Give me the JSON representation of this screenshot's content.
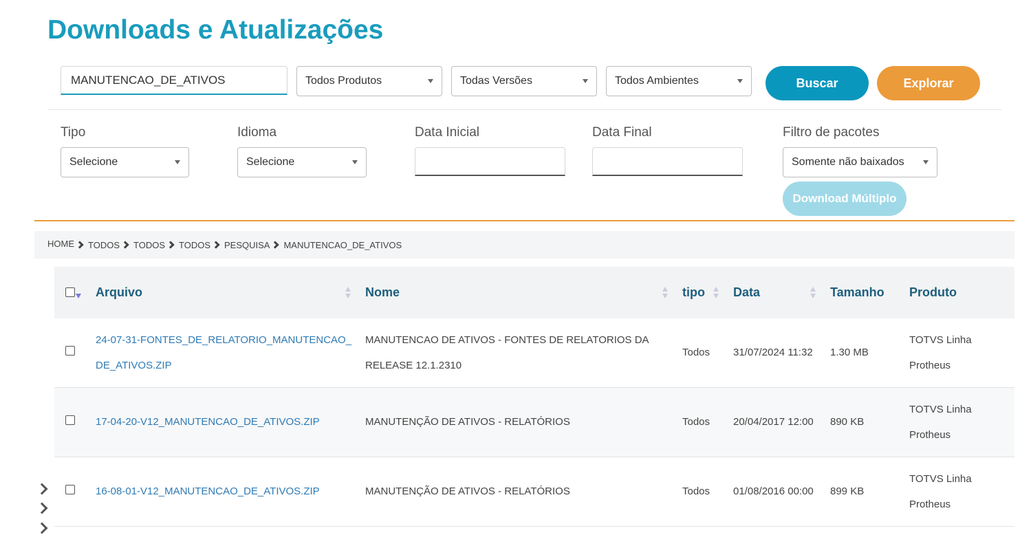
{
  "page_title": "Downloads e Atualizações",
  "search": {
    "value": "MANUTENCAO_DE_ATIVOS"
  },
  "selects": {
    "produtos": "Todos Produtos",
    "versoes": "Todas Versões",
    "ambientes": "Todos Ambientes"
  },
  "buttons": {
    "buscar": "Buscar",
    "explorar": "Explorar",
    "download_multiplo": "Download Múltiplo"
  },
  "filters": {
    "tipo": {
      "label": "Tipo",
      "value": "Selecione"
    },
    "idioma": {
      "label": "Idioma",
      "value": "Selecione"
    },
    "data_inicial": {
      "label": "Data Inicial",
      "value": ""
    },
    "data_final": {
      "label": "Data Final",
      "value": ""
    },
    "filtro_pacotes": {
      "label": "Filtro de pacotes",
      "value": "Somente não baixados"
    }
  },
  "breadcrumb": [
    "HOME",
    "TODOS",
    "TODOS",
    "TODOS",
    "PESQUISA",
    "MANUTENCAO_DE_ATIVOS"
  ],
  "table": {
    "headers": {
      "arquivo": "Arquivo",
      "nome": "Nome",
      "tipo": "tipo",
      "data": "Data",
      "tamanho": "Tamanho",
      "produto": "Produto"
    },
    "rows": [
      {
        "arquivo_l1": "24-07-31-FONTES_DE_RELATORIO_MANUTENCAO_",
        "arquivo_l2": "DE_ATIVOS.ZIP",
        "nome_l1": "MANUTENCAO DE ATIVOS - FONTES DE RELATORIOS DA",
        "nome_l2": "RELEASE 12.1.2310",
        "tipo": "Todos",
        "data": "31/07/2024 11:32",
        "tamanho": "1.30 MB",
        "produto_l1": "TOTVS Linha",
        "produto_l2": "Protheus"
      },
      {
        "arquivo_l1": "17-04-20-V12_MANUTENCAO_DE_ATIVOS.ZIP",
        "arquivo_l2": "",
        "nome_l1": "MANUTENÇÃO DE ATIVOS - RELATÓRIOS",
        "nome_l2": "",
        "tipo": "Todos",
        "data": "20/04/2017 12:00",
        "tamanho": "890 KB",
        "produto_l1": "TOTVS Linha",
        "produto_l2": "Protheus"
      },
      {
        "arquivo_l1": "16-08-01-V12_MANUTENCAO_DE_ATIVOS.ZIP",
        "arquivo_l2": "",
        "nome_l1": "MANUTENÇÃO DE ATIVOS - RELATÓRIOS",
        "nome_l2": "",
        "tipo": "Todos",
        "data": "01/08/2016 00:00",
        "tamanho": "899 KB",
        "produto_l1": "TOTVS Linha",
        "produto_l2": "Protheus"
      }
    ]
  },
  "colors": {
    "title": "#1a9cbd",
    "buscar": "#0a97bd",
    "explorar": "#ec9b3b",
    "download_disabled": "#9fd9e8",
    "link": "#2f7bb5",
    "header_text": "#1d5f7e"
  },
  "icons": [
    "chevron-right-icon",
    "caret-down-icon",
    "sort-icon",
    "checkbox-icon"
  ]
}
